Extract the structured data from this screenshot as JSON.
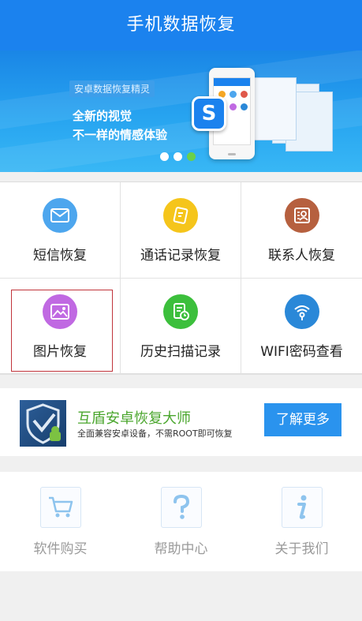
{
  "header": {
    "title": "手机数据恢复"
  },
  "banner": {
    "tag": "安卓数据恢复精灵",
    "slogan_line1": "全新的视觉",
    "slogan_line2": "不一样的情感体验",
    "logo_letter": "S",
    "carousel_active_index": 2,
    "carousel_count": 3
  },
  "grid": {
    "items": [
      {
        "label": "短信恢复",
        "icon": "envelope-icon",
        "color": "#4da6ee"
      },
      {
        "label": "通话记录恢复",
        "icon": "phone-note-icon",
        "color": "#f5c51b"
      },
      {
        "label": "联系人恢复",
        "icon": "contact-card-icon",
        "color": "#b6603f"
      },
      {
        "label": "图片恢复",
        "icon": "image-icon",
        "color": "#c069e2"
      },
      {
        "label": "历史扫描记录",
        "icon": "history-doc-icon",
        "color": "#3cbf3c"
      },
      {
        "label": "WIFI密码查看",
        "icon": "wifi-lock-icon",
        "color": "#2a88d8"
      }
    ],
    "selected_index": 3
  },
  "promo": {
    "title": "互盾安卓恢复大师",
    "subtitle": "全面兼容安卓设备，不需ROOT即可恢复",
    "button_label": "了解更多"
  },
  "bottom_nav": {
    "items": [
      {
        "label": "软件购买",
        "icon": "cart-icon"
      },
      {
        "label": "帮助中心",
        "icon": "question-icon"
      },
      {
        "label": "关于我们",
        "icon": "info-icon"
      }
    ]
  },
  "colors": {
    "header_bg": "#1b82ee",
    "accent_green": "#4aa62d",
    "button_blue": "#2a93ee",
    "selection_border": "#c0343b"
  }
}
